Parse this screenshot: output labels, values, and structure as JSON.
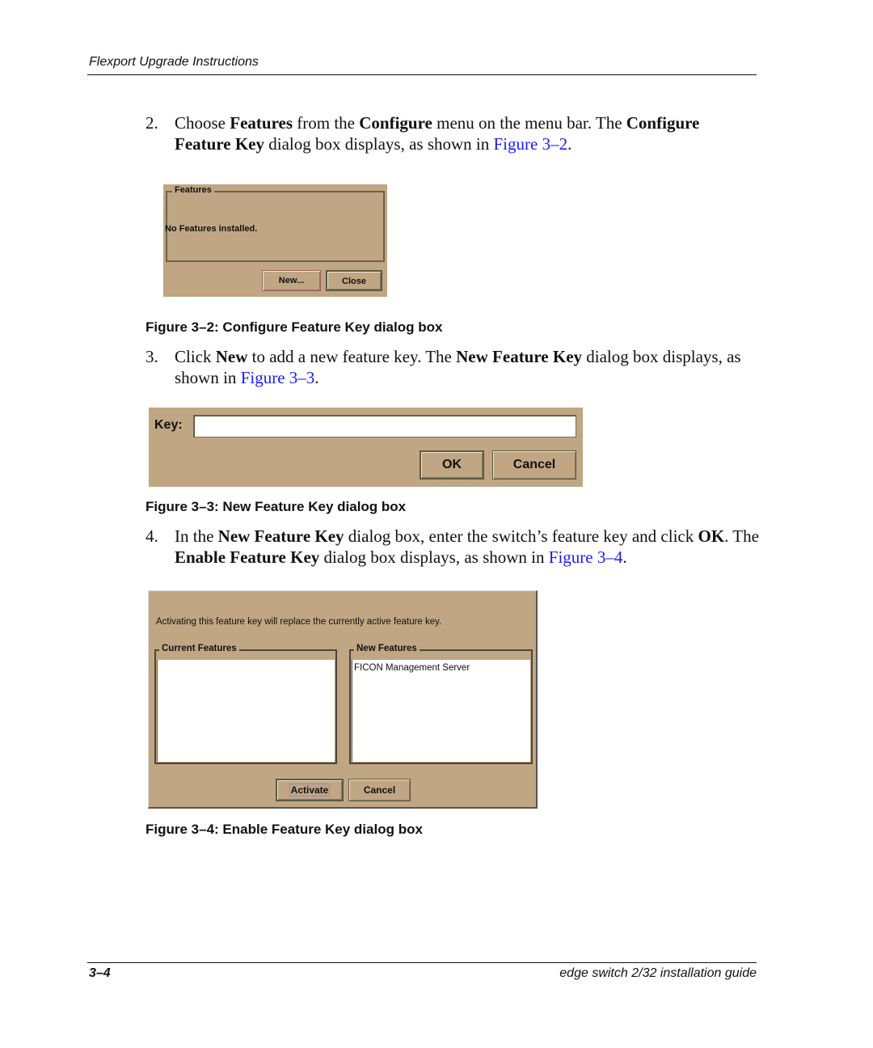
{
  "header": {
    "running_title": "Flexport Upgrade Instructions"
  },
  "steps": [
    {
      "number": "2.",
      "parts": [
        {
          "t": "Choose ",
          "b": false
        },
        {
          "t": "Features",
          "b": true
        },
        {
          "t": " from the ",
          "b": false
        },
        {
          "t": "Configure",
          "b": true
        },
        {
          "t": " menu on the menu bar. The ",
          "b": false
        },
        {
          "t": "Configure Feature Key",
          "b": true
        },
        {
          "t": " dialog box displays, as shown in ",
          "b": false
        },
        {
          "t": "Figure 3–2",
          "link": true
        },
        {
          "t": ".",
          "b": false
        }
      ]
    },
    {
      "number": "3.",
      "parts": [
        {
          "t": "Click ",
          "b": false
        },
        {
          "t": "New",
          "b": true
        },
        {
          "t": " to add a new feature key. The ",
          "b": false
        },
        {
          "t": "New Feature Key",
          "b": true
        },
        {
          "t": " dialog box displays, as shown in ",
          "b": false
        },
        {
          "t": "Figure 3–3",
          "link": true
        },
        {
          "t": ".",
          "b": false
        }
      ]
    },
    {
      "number": "4.",
      "parts": [
        {
          "t": "In the ",
          "b": false
        },
        {
          "t": "New Feature Key",
          "b": true
        },
        {
          "t": " dialog box, enter the switch’s feature key and click ",
          "b": false
        },
        {
          "t": "OK",
          "b": true
        },
        {
          "t": ". The ",
          "b": false
        },
        {
          "t": "Enable Feature Key",
          "b": true
        },
        {
          "t": " dialog box displays, as shown in ",
          "b": false
        },
        {
          "t": "Figure 3–4",
          "link": true
        },
        {
          "t": ".",
          "b": false
        }
      ]
    }
  ],
  "figures": {
    "fig2": {
      "caption": "Figure 3–2:  Configure Feature Key dialog box",
      "group_title": "Features",
      "message": "No Features installed.",
      "new_button": "New...",
      "close_button": "Close"
    },
    "fig3": {
      "caption": "Figure 3–3:  New Feature Key dialog box",
      "key_label": "Key:",
      "key_value": "",
      "ok_button": "OK",
      "cancel_button": "Cancel"
    },
    "fig4": {
      "caption": "Figure 3–4:  Enable Feature Key dialog box",
      "notice": "Activating this feature key will replace the currently active feature key.",
      "current_title": "Current Features",
      "current_items": [],
      "new_title": "New Features",
      "new_items": [
        "FICON Management Server"
      ],
      "activate_button": "Activate",
      "cancel_button": "Cancel"
    }
  },
  "colors": {
    "dialog_bg": "#c0a683",
    "link": "#1a1aff"
  },
  "footer": {
    "page_number": "3–4",
    "book_title": "edge switch 2/32 installation guide"
  }
}
